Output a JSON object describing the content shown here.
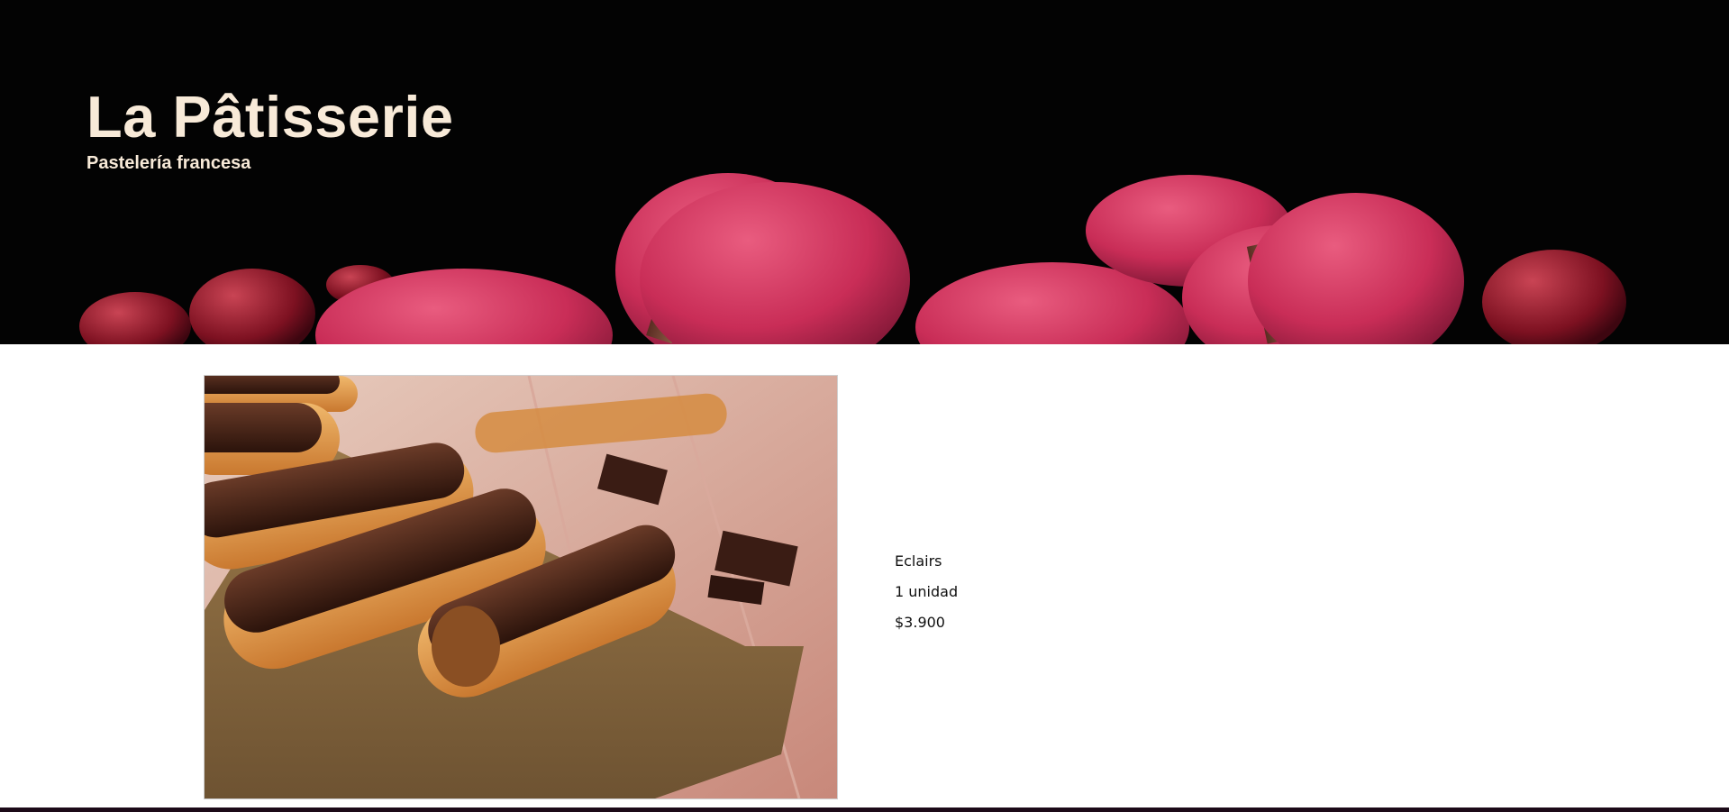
{
  "site": {
    "title": "La Pâtisserie",
    "subtitle": "Pastelería francesa"
  },
  "hero": {
    "image_icon": "macarons-banner-image",
    "colors": {
      "background": "#030303",
      "macaron": "#c92d57",
      "text": "#f8ead8"
    }
  },
  "product": {
    "image_icon": "eclairs-photo",
    "name": "Eclairs",
    "quantity": "1 unidad",
    "price": "$3.900"
  },
  "footer": {
    "color": "#1c0a18"
  }
}
